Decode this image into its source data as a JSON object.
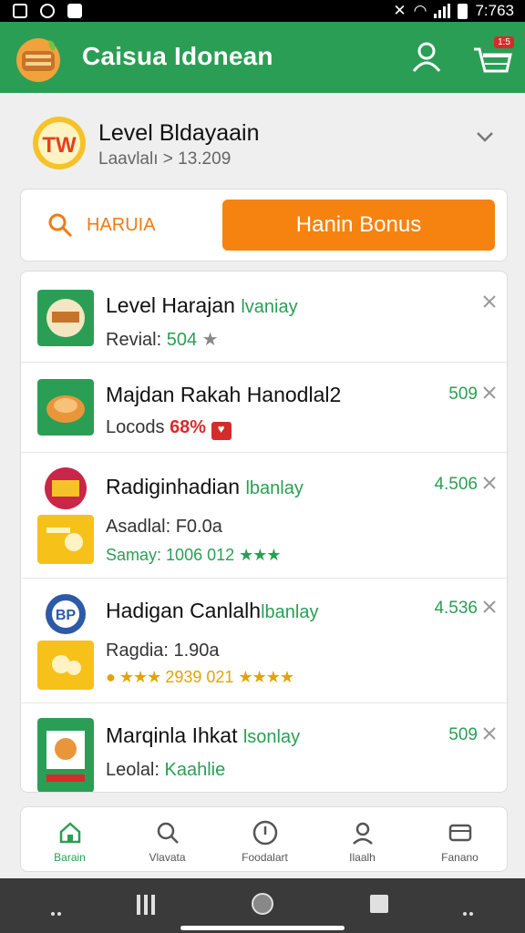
{
  "status_bar": {
    "time": "7:763"
  },
  "app_bar": {
    "title": "Caisua Idonean",
    "cart_badge": "1:5"
  },
  "level": {
    "title": "Level Bldayaain",
    "subtitle": "Laavlalı > 13.209",
    "badge_text": "TW"
  },
  "actions": {
    "search_label": "HARUIA",
    "bonus_label": "Hanin Bonus"
  },
  "items": [
    {
      "name": "Level Harajan",
      "tag": "lvaniay",
      "line2_label": "Revial:",
      "line2_value": "504",
      "price": ""
    },
    {
      "name": "Majdan Rakah Hanodlal2",
      "tag": "",
      "line2_label": "Locods",
      "line2_value": "68%",
      "price": "509"
    },
    {
      "name": "Radiginhadian",
      "tag": "lbanlay",
      "line2_label": "Asadlal: F0.0a",
      "line3_label": "Samay:",
      "line3_value": "1006 012",
      "price": "4.506"
    },
    {
      "name": "Hadigan Canlalh",
      "tag": "lbanlay",
      "line2_label": "Ragdia: 1.90a",
      "line3_value": "2939 021",
      "price": "4.536"
    },
    {
      "name": "Marqinla Ihkat",
      "tag": "lsonlay",
      "line2_label": "Leolal:",
      "line2_value": "Kaahlie",
      "price": "509"
    }
  ],
  "bottom_nav": [
    {
      "label": "Barain",
      "icon": "home-icon",
      "active": true
    },
    {
      "label": "Vlavata",
      "icon": "search-icon",
      "active": false
    },
    {
      "label": "Foodalart",
      "icon": "compass-icon",
      "active": false
    },
    {
      "label": "Ilaalh",
      "icon": "profile-icon",
      "active": false
    },
    {
      "label": "Fanano",
      "icon": "wallet-icon",
      "active": false
    }
  ],
  "colors": {
    "primary": "#2b9e55",
    "accent": "#f6830f",
    "danger": "#d62b2b"
  }
}
